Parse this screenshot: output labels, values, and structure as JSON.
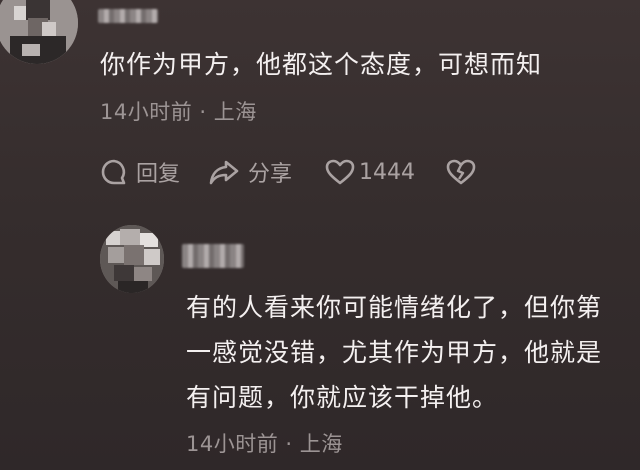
{
  "comment1": {
    "text": "你作为甲方，他都这个态度，可想而知",
    "meta": "14小时前 · 上海",
    "actions": {
      "reply_label": "回复",
      "share_label": "分享",
      "like_count": "1444"
    }
  },
  "reply1": {
    "lines": [
      "有的人看来你可能情绪化了，但你第",
      "一感觉没错，尤其作为甲方，他就是",
      "有问题，你就应该干掉他。"
    ],
    "meta": "14小时前 · 上海"
  },
  "icons": {
    "reply": "comment-bubble-icon",
    "share": "share-arrow-icon",
    "like": "heart-outline-icon",
    "dislike": "broken-heart-icon"
  },
  "colors": {
    "background": "#352d2d",
    "text": "#f4f0f0",
    "meta": "#9c9494",
    "action": "#aaa2a2"
  }
}
